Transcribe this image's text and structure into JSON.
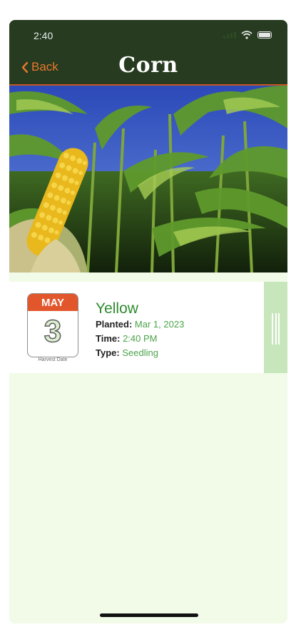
{
  "status_bar": {
    "time": "2:40"
  },
  "nav": {
    "back_label": "Back",
    "title": "Corn"
  },
  "plant": {
    "harvest_month": "MAY",
    "harvest_day": "3",
    "harvest_caption": "Harvest Date",
    "variety": "Yellow",
    "planted_label": "Planted:",
    "planted_value": "Mar 1, 2023",
    "time_label": "Time:",
    "time_value": "2:40 PM",
    "type_label": "Type:",
    "type_value": "Seedling"
  },
  "icons": [
    "chevron-left-icon",
    "signal-icon",
    "wifi-icon",
    "battery-icon",
    "drag-handle-icon"
  ],
  "colors": {
    "header_bg": "#263b1f",
    "accent": "#e7772f",
    "calendar_red": "#e2562c",
    "value_green": "#4aa34a",
    "page_bg": "#f1fbe8"
  }
}
